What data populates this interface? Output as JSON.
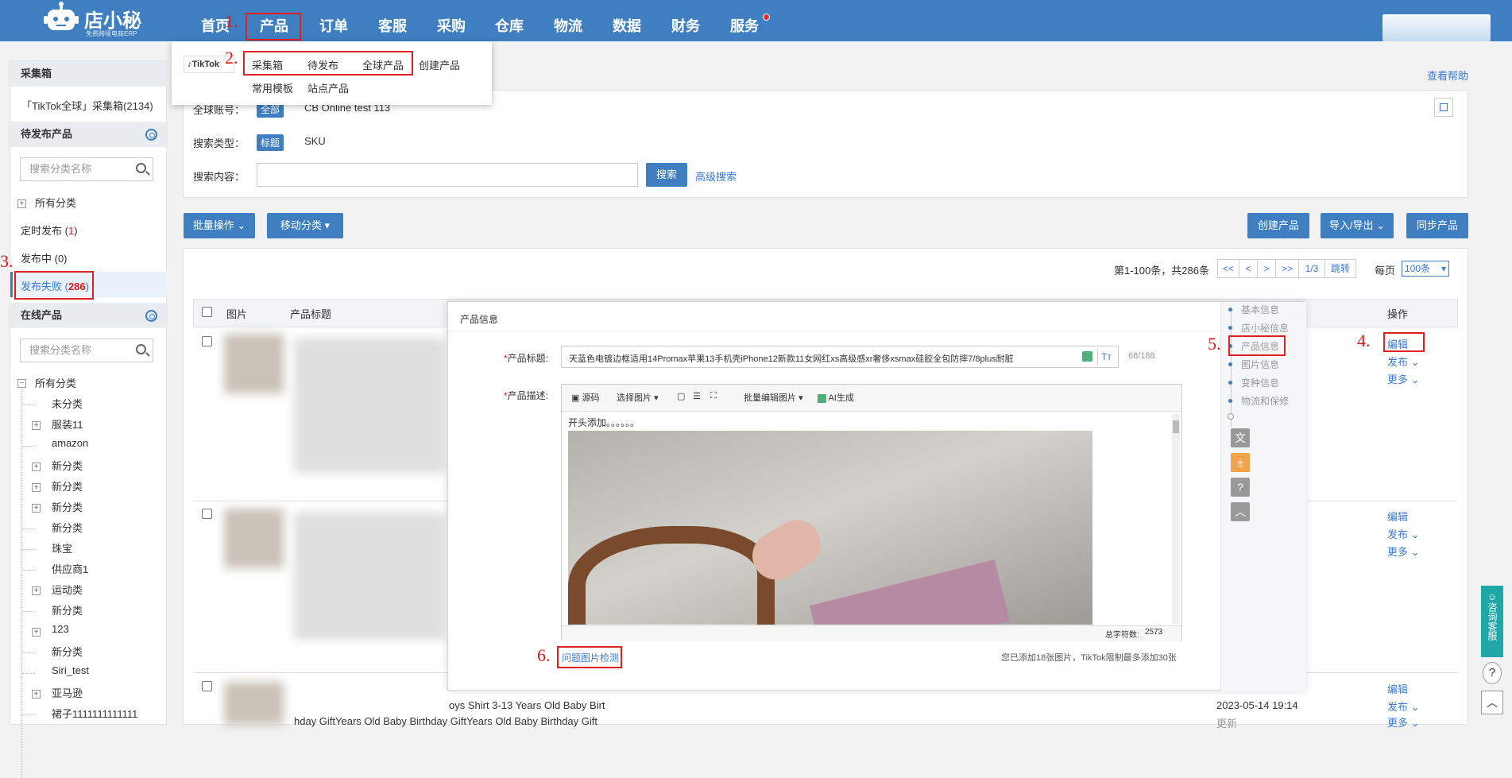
{
  "app": {
    "logo_text": "店小秘",
    "logo_sub": "免费跨境电商ERP"
  },
  "nav": [
    "首页",
    "产品",
    "订单",
    "客服",
    "采购",
    "仓库",
    "物流",
    "数据",
    "财务",
    "服务"
  ],
  "annotations": [
    "1.",
    "2.",
    "3.",
    "4.",
    "5.",
    "6."
  ],
  "dropdown": {
    "platform": "TikTok",
    "row1": [
      "采集箱",
      "待发布",
      "全球产品",
      "创建产品"
    ],
    "row2": [
      "常用模板",
      "站点产品"
    ]
  },
  "sidebar": {
    "collect_head": "采集箱",
    "collect_item": "「TikTok全球」采集箱(2134)",
    "pending_head": "待发布产品",
    "search_placeholder": "搜索分类名称",
    "all_category": "所有分类",
    "timed_label": "定时发布 (",
    "timed_count": "1",
    "timed_close": ")",
    "publishing": "发布中 (0)",
    "failed_label": "发布失败 (",
    "failed_count": "286",
    "failed_close": ")",
    "online_head": "在线产品",
    "online_search_placeholder": "搜索分类名称",
    "online_all": "所有分类",
    "tree": [
      "未分类",
      "服装11",
      "amazon",
      "新分类",
      "新分类",
      "新分类",
      "新分类",
      "珠宝",
      "供应商1",
      "运动类",
      "新分类",
      "123",
      "新分类",
      "Siri_test",
      "亚马逊",
      "裙子1111111111111"
    ]
  },
  "main": {
    "help_link": "查看帮助",
    "account_label": "全球账号：",
    "account_tag": "全部",
    "account_value": "CB Online test 113",
    "search_type_label": "搜索类型：",
    "search_type_tag": "标题",
    "search_type_sku": "SKU",
    "search_content_label": "搜索内容：",
    "search_button": "搜索",
    "advanced_search": "高级搜索",
    "batch_btn": "批量操作",
    "move_btn": "移动分类",
    "create_btn": "创建产品",
    "import_btn": "导入/导出",
    "sync_btn": "同步产品",
    "pagination": {
      "summary": "第1-100条，共286条",
      "buttons": [
        "<<",
        "<",
        ">",
        ">>",
        "1/3",
        "跳转"
      ],
      "per_page_label": "每页",
      "per_page_value": "100条"
    },
    "table_headers": [
      "图片",
      "产品标题",
      "操作"
    ],
    "row_ops": {
      "edit": "编辑",
      "publish": "发布",
      "more": "更多"
    },
    "row3_title_a": "oys Shirt 3-13 Years Old Baby Birt",
    "row3_title_b": "hday GiftYears Old Baby Birthday GiftYears Old Baby Birthday Gift",
    "row3_date": "2023-05-14 19:14",
    "row3_op": "更新"
  },
  "modal": {
    "header": "产品信息",
    "title_label": "产品标题:",
    "title_value": "天蓝色电镀边框适用14Promax苹果13手机壳iPhone12新款11女网红xs高级感xr奢侈xsmax硅胶全包防摔7/8plus耐脏",
    "title_count": "68/188",
    "desc_label": "产品描述:",
    "toolbar": {
      "source": "源码",
      "select_image": "选择图片",
      "batch_edit": "批量编辑图片",
      "ai": "AI生成"
    },
    "editor_text": "开头添加。。。。。。",
    "char_count_label": "总字符数:",
    "char_count": "2573",
    "check_link": "问题图片检测",
    "image_notice": "您已添加18张图片，TikTok限制最多添加30张",
    "side_nav": [
      "基本信息",
      "店小秘信息",
      "产品信息",
      "图片信息",
      "变种信息",
      "物流和保修"
    ]
  },
  "float": {
    "consult": "咨询客服",
    "help": "?"
  },
  "colors": {
    "brand": "#3f7fc1",
    "annotation": "#e21818",
    "failed": "#e21818"
  }
}
